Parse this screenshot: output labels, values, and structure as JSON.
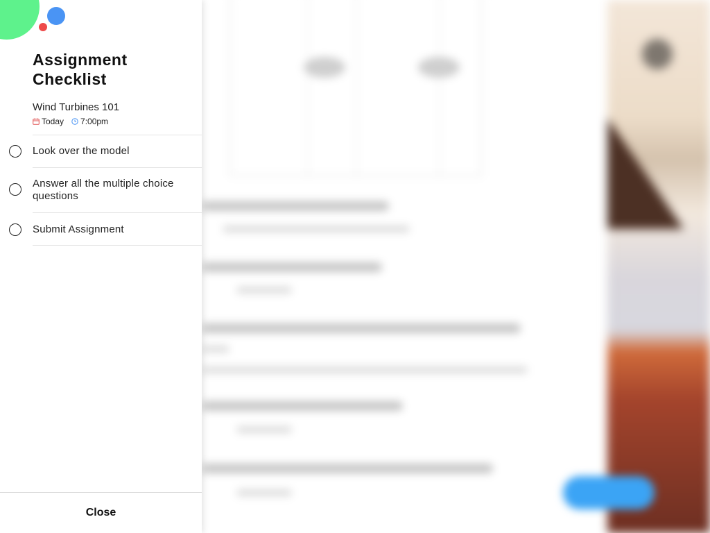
{
  "checklist": {
    "title_line1": "Assignment",
    "title_line2": "Checklist",
    "assignment_name": "Wind Turbines 101",
    "due_day": "Today",
    "due_time": "7:00pm",
    "tasks": [
      {
        "label": "Look over the model",
        "completed": false
      },
      {
        "label": "Answer all the multiple choice questions",
        "completed": false
      },
      {
        "label": "Submit Assignment",
        "completed": false
      }
    ],
    "close_label": "Close"
  },
  "colors": {
    "accent_green": "#5ef28c",
    "accent_blue": "#4a94f4",
    "accent_red": "#ee4b4b",
    "calendar_icon": "#e05252",
    "clock_icon": "#4a94f4"
  },
  "icons": {
    "calendar": "calendar-icon",
    "clock": "clock-icon",
    "task_status": "radio-circle-icon"
  }
}
